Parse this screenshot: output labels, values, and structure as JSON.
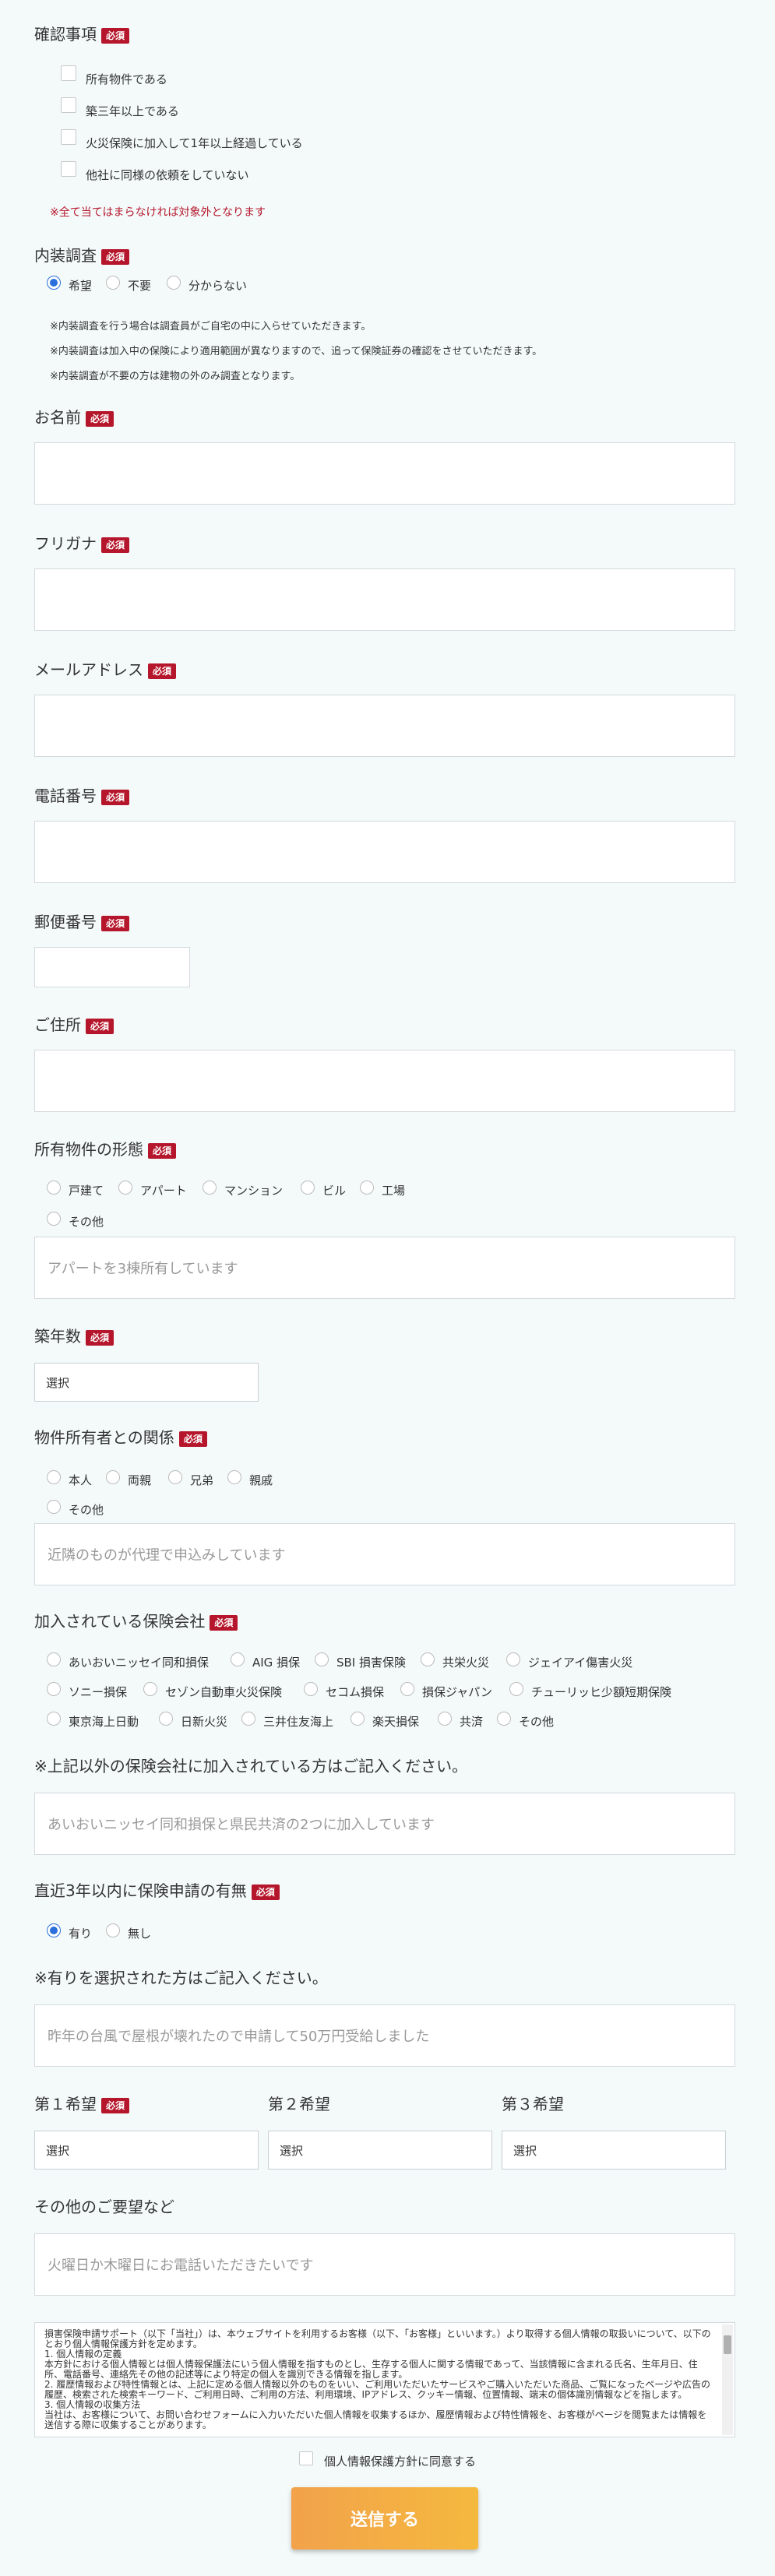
{
  "required_badge": "必須",
  "confirm": {
    "label": "確認事項",
    "items": [
      "所有物件である",
      "築三年以上である",
      "火災保険に加入して1年以上経過している",
      "他社に同様の依頼をしていない"
    ],
    "note": "※全て当てはまらなければ対象外となります"
  },
  "interior": {
    "label": "内装調査",
    "options": [
      "希望",
      "不要",
      "分からない"
    ],
    "selected": "希望",
    "notes": [
      "※内装調査を行う場合は調査員がご自宅の中に入らせていただきます。",
      "※内装調査は加入中の保険により適用範囲が異なりますので、追って保険証券の確認をさせていただきます。",
      "※内装調査が不要の方は建物の外のみ調査となります。"
    ]
  },
  "name": {
    "label": "お名前",
    "value": ""
  },
  "furigana": {
    "label": "フリガナ",
    "value": ""
  },
  "email": {
    "label": "メールアドレス",
    "value": ""
  },
  "phone": {
    "label": "電話番号",
    "value": ""
  },
  "zip": {
    "label": "郵便番号",
    "value": ""
  },
  "address": {
    "label": "ご住所",
    "value": ""
  },
  "property_type": {
    "label": "所有物件の形態",
    "options": [
      "戸建て",
      "アパート",
      "マンション",
      "ビル",
      "工場",
      "その他"
    ],
    "placeholder": "アパートを3棟所有しています"
  },
  "age": {
    "label": "築年数",
    "select": "選択"
  },
  "relation": {
    "label": "物件所有者との関係",
    "options": [
      "本人",
      "両親",
      "兄弟",
      "親戚",
      "その他"
    ],
    "placeholder": "近隣のものが代理で申込みしています"
  },
  "insurer": {
    "label": "加入されている保険会社",
    "options_row1": [
      "あいおいニッセイ同和損保",
      "AIG 損保",
      "SBI 損害保険",
      "共栄火災",
      "ジェイアイ傷害火災"
    ],
    "options_row2": [
      "ソニー損保",
      "セゾン自動車火災保険",
      "セコム損保",
      "損保ジャパン",
      "チューリッヒ少額短期保険"
    ],
    "options_row3": [
      "東京海上日動",
      "日新火災",
      "三井住友海上",
      "楽天損保",
      "共済",
      "その他"
    ],
    "other_label": "※上記以外の保険会社に加入されている方はご記入ください。",
    "other_placeholder": "あいおいニッセイ同和損保と県民共済の2つに加入しています"
  },
  "claim": {
    "label": "直近3年以内に保険申請の有無",
    "options": [
      "有り",
      "無し"
    ],
    "selected": "有り",
    "detail_label": "※有りを選択された方はご記入ください。",
    "detail_placeholder": "昨年の台風で屋根が壊れたので申請して50万円受給しました"
  },
  "wish": {
    "label1": "第１希望",
    "label2": "第２希望",
    "label3": "第３希望",
    "select": "選択"
  },
  "other": {
    "label": "その他のご要望など",
    "placeholder": "火曜日か木曜日にお電話いただきたいです"
  },
  "privacy": {
    "text": "損害保険申請サポート（以下「当社」）は、本ウェブサイトを利用するお客様（以下、「お客様」といいます。）より取得する個人情報の取扱いについて、以下のとおり個人情報保護方針を定めます。\n1. 個人情報の定義\n本方針における個人情報とは個人情報保護法にいう個人情報を指すものとし、生存する個人に関する情報であって、当該情報に含まれる氏名、生年月日、住所、電話番号、連絡先その他の記述等により特定の個人を識別できる情報を指します。\n2. 履歴情報および特性情報とは、上記に定める個人情報以外のものをいい、ご利用いただいたサービスやご購入いただいた商品、ご覧になったページや広告の履歴、検索された検索キーワード、ご利用日時、ご利用の方法、利用環境、IPアドレス、クッキー情報、位置情報、端末の個体識別情報などを指します。\n3. 個人情報の収集方法\n当社は、お客様について、お問い合わせフォームに入力いただいた個人情報を収集するほか、履歴情報および特性情報を、お客様がページを閲覧または情報を送信する際に収集することがあります。",
    "agree": "個人情報保護方針に同意する"
  },
  "submit": "送信する"
}
